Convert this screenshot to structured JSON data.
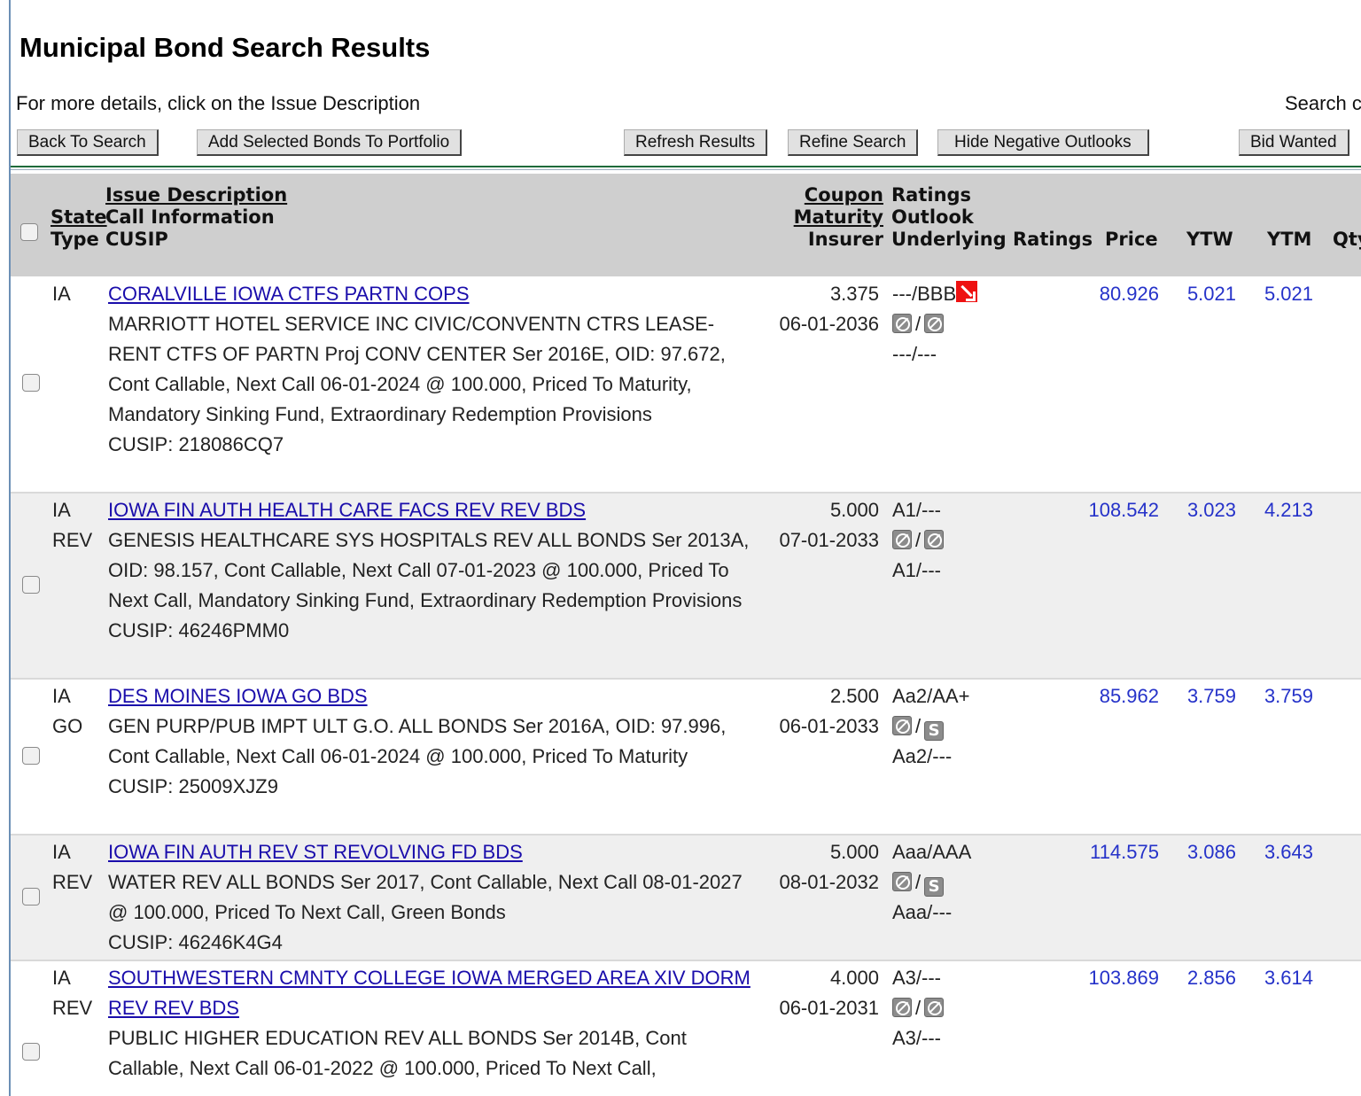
{
  "page": {
    "title": "Municipal Bond Search Results",
    "note": "For more details, click on the Issue Description",
    "search_partial": "Search c"
  },
  "toolbar": {
    "back": "Back To Search",
    "add": "Add Selected Bonds To Portfolio",
    "refresh": "Refresh Results",
    "refine": "Refine Search",
    "hide": "Hide Negative Outlooks",
    "bid": "Bid Wanted"
  },
  "header": {
    "state": "State",
    "type": "Type",
    "issue": "Issue Description",
    "call": "Call Information",
    "cusip": "CUSIP",
    "coupon": "Coupon",
    "maturity": "Maturity",
    "insurer": "Insurer",
    "ratings": "Ratings",
    "outlook": "Outlook",
    "underlying": "Underlying Ratings",
    "price": "Price",
    "ytw": "YTW",
    "ytm": "YTM",
    "qty": "Qty"
  },
  "rows": [
    {
      "state": "IA",
      "type": "",
      "title": "CORALVILLE IOWA CTFS PARTN COPS",
      "desc": "MARRIOTT HOTEL SERVICE INC CIVIC/CONVENTN CTRS LEASE-RENT CTFS OF PARTN Proj CONV CENTER Ser 2016E, OID: 97.672, Cont Callable, Next Call 06-01-2024 @ 100.000, Priced To Maturity, Mandatory Sinking Fund, Extraordinary Redemption Provisions",
      "cusip": "CUSIP: 218086CQ7",
      "coupon": "3.375",
      "maturity": "06-01-2036",
      "ratings": "---/BBB",
      "underlying": "---/---",
      "price": "80.926",
      "ytw": "5.021",
      "ytm": "5.021"
    },
    {
      "state": "IA",
      "type": "REV",
      "title": "IOWA FIN AUTH HEALTH CARE FACS REV REV BDS",
      "desc": "GENESIS HEALTHCARE SYS HOSPITALS REV ALL BONDS Ser 2013A, OID: 98.157, Cont Callable, Next Call 07-01-2023 @ 100.000, Priced To Next Call, Mandatory Sinking Fund, Extraordinary Redemption Provisions",
      "cusip": "CUSIP: 46246PMM0",
      "coupon": "5.000",
      "maturity": "07-01-2033",
      "ratings": "A1/---",
      "underlying": "A1/---",
      "price": "108.542",
      "ytw": "3.023",
      "ytm": "4.213"
    },
    {
      "state": "IA",
      "type": "GO",
      "title": "DES MOINES IOWA GO BDS",
      "desc": "GEN PURP/PUB IMPT ULT G.O. ALL BONDS Ser 2016A, OID: 97.996, Cont Callable, Next Call 06-01-2024 @ 100.000, Priced To Maturity",
      "cusip": "CUSIP: 25009XJZ9",
      "coupon": "2.500",
      "maturity": "06-01-2033",
      "ratings": "Aa2/AA+",
      "underlying": "Aa2/---",
      "outlook_s": "S",
      "price": "85.962",
      "ytw": "3.759",
      "ytm": "3.759"
    },
    {
      "state": "IA",
      "type": "REV",
      "title": "IOWA FIN AUTH REV ST REVOLVING FD BDS",
      "desc": "WATER REV ALL BONDS Ser 2017, Cont Callable, Next Call 08-01-2027 @ 100.000, Priced To Next Call, Green Bonds",
      "cusip": "CUSIP: 46246K4G4",
      "coupon": "5.000",
      "maturity": "08-01-2032",
      "ratings": "Aaa/AAA",
      "underlying": "Aaa/---",
      "outlook_s": "S",
      "price": "114.575",
      "ytw": "3.086",
      "ytm": "3.643"
    },
    {
      "state": "IA",
      "type": "REV",
      "title": "SOUTHWESTERN CMNTY COLLEGE IOWA MERGED AREA XIV DORM REV REV BDS",
      "desc": "PUBLIC HIGHER EDUCATION REV ALL BONDS Ser 2014B, Cont Callable, Next Call 06-01-2022 @ 100.000, Priced To Next Call,",
      "coupon": "4.000",
      "maturity": "06-01-2031",
      "ratings": "A3/---",
      "underlying": "A3/---",
      "price": "103.869",
      "ytw": "2.856",
      "ytm": "3.614"
    }
  ],
  "colors": {
    "link": "#1a0dab",
    "value": "#2532c9",
    "header_bg": "#cfcfcf",
    "alt_row": "#efefef",
    "negative": "#e11"
  }
}
